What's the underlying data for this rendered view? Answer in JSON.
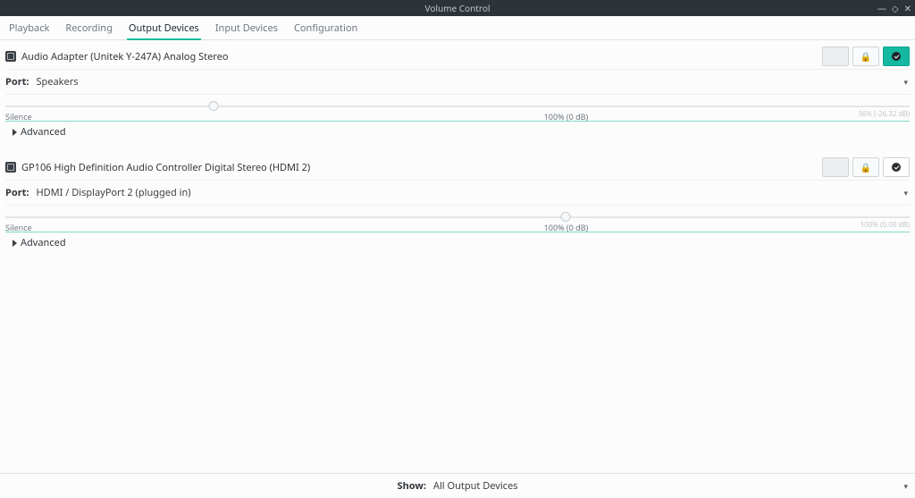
{
  "window": {
    "title": "Volume Control"
  },
  "tabs": [
    "Playback",
    "Recording",
    "Output Devices",
    "Input Devices",
    "Configuration"
  ],
  "active_tab_index": 2,
  "devices": [
    {
      "name": "Audio Adapter (Unitek Y-247A) Analog Stereo",
      "port_label": "Port:",
      "port_value": "Speakers",
      "is_default": true,
      "volume_percent": 36,
      "scale_left": "Silence",
      "scale_center": "100% (0 dB)",
      "scale_right": "36% (-26.32 dB)",
      "advanced_label": "Advanced"
    },
    {
      "name": "GP106 High Definition Audio Controller Digital Stereo (HDMI 2)",
      "port_label": "Port:",
      "port_value": "HDMI / DisplayPort 2 (plugged in)",
      "is_default": false,
      "volume_percent": 100,
      "scale_left": "Silence",
      "scale_center": "100% (0 dB)",
      "scale_right": "100% (0.00 dB)",
      "advanced_label": "Advanced"
    }
  ],
  "bottom": {
    "show_label": "Show:",
    "show_value": "All Output Devices"
  }
}
